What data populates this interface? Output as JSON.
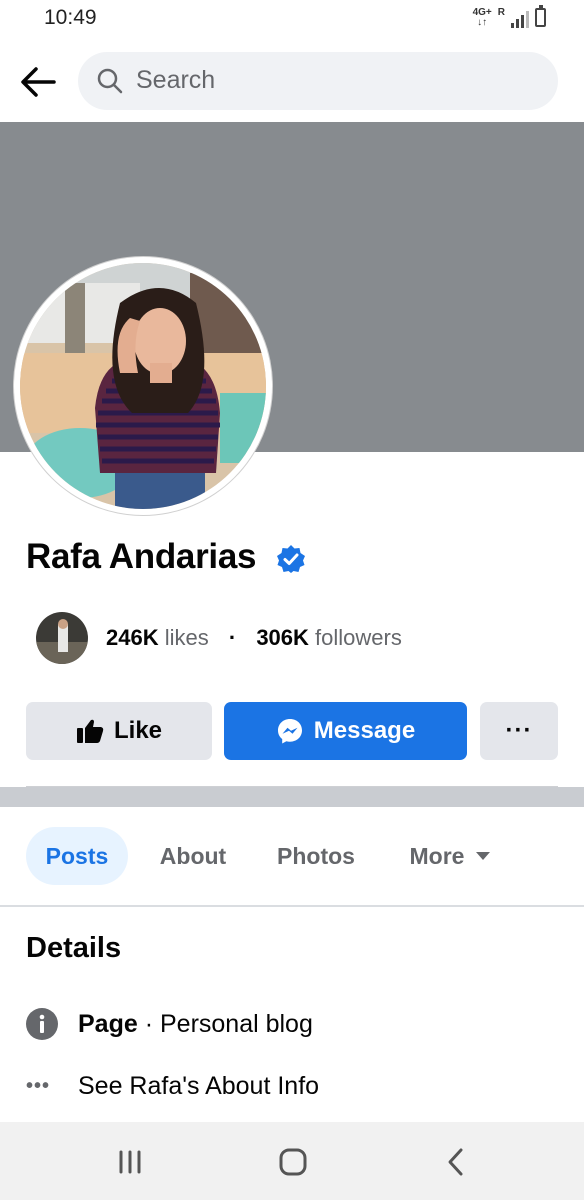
{
  "status_bar": {
    "time": "10:49",
    "network": "4G+",
    "roaming": "R"
  },
  "search": {
    "placeholder": "Search"
  },
  "profile": {
    "name": "Rafa Andarias",
    "likes_count": "246K",
    "likes_label": "likes",
    "followers_count": "306K",
    "followers_label": "followers",
    "separator": "·"
  },
  "actions": {
    "like_label": "Like",
    "message_label": "Message",
    "more_label": "···"
  },
  "tabs": [
    {
      "label": "Posts",
      "selected": true
    },
    {
      "label": "About",
      "selected": false
    },
    {
      "label": "Photos",
      "selected": false
    },
    {
      "label": "More",
      "selected": false
    }
  ],
  "details": {
    "title": "Details",
    "category_type": "Page",
    "category_sep": " · ",
    "category_value": "Personal blog",
    "about_link": "See Rafa's About Info"
  },
  "colors": {
    "accent": "#1b74e4",
    "cover": "#878b8f",
    "button_gray": "#e4e6eb",
    "secondary_text": "#65676b"
  },
  "icons": [
    "back-arrow-icon",
    "search-icon",
    "verified-badge-icon",
    "thumbs-up-icon",
    "messenger-icon",
    "more-dots-icon",
    "caret-down-icon",
    "info-icon",
    "recent-apps-icon",
    "home-icon",
    "nav-back-icon"
  ]
}
